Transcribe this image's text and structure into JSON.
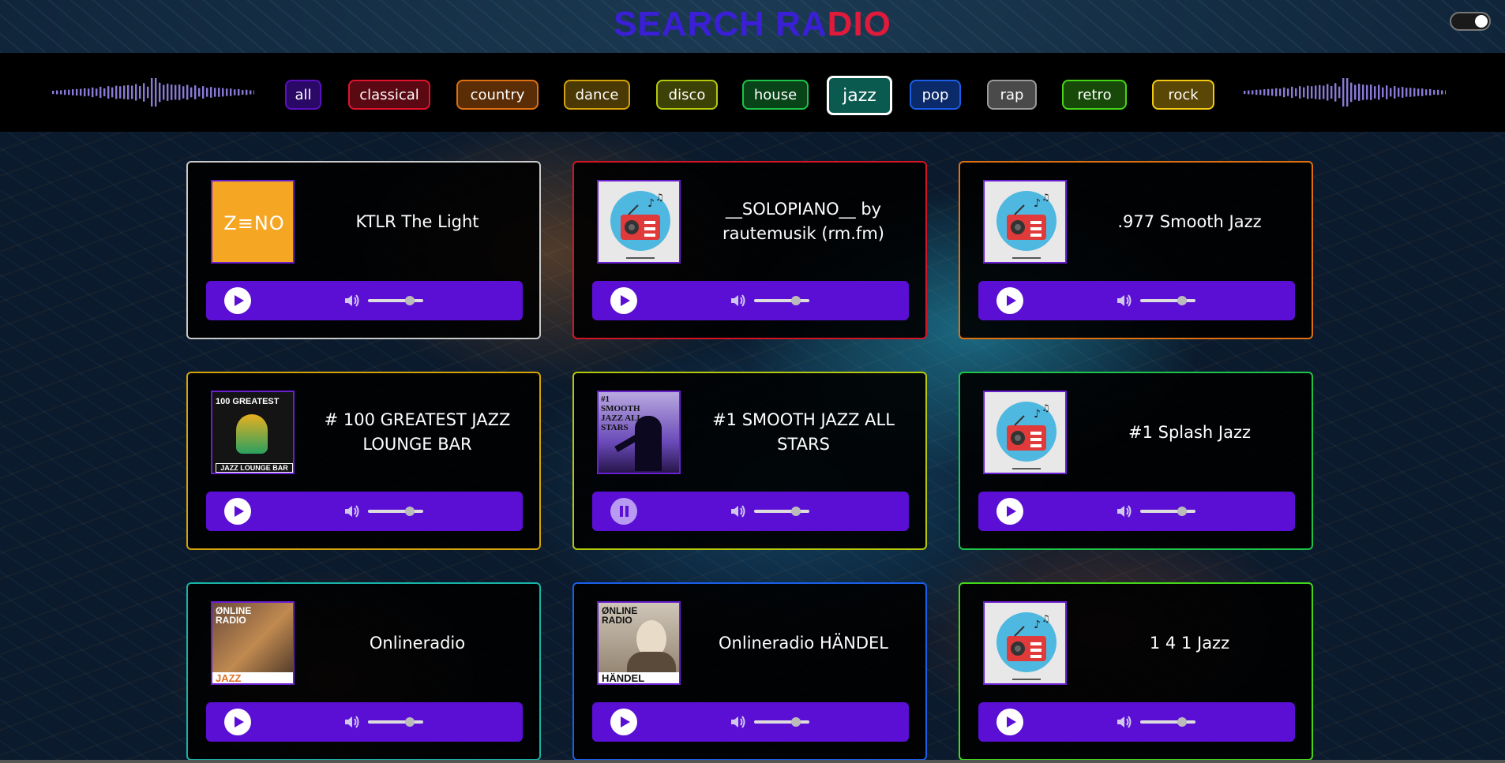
{
  "header": {
    "title_part1": "SEARCH RA",
    "title_part2": "DIO"
  },
  "genres": [
    {
      "label": "all",
      "color": "#5a10c0",
      "bg": "#2a0866"
    },
    {
      "label": "classical",
      "color": "#e0132d",
      "bg": "#5a0812"
    },
    {
      "label": "country",
      "color": "#e07010",
      "bg": "#5a2d06"
    },
    {
      "label": "dance",
      "color": "#d4a30a",
      "bg": "#4a3905"
    },
    {
      "label": "disco",
      "color": "#b5c80e",
      "bg": "#3c4205"
    },
    {
      "label": "house",
      "color": "#1ec34a",
      "bg": "#094418"
    },
    {
      "label": "jazz",
      "color": "#ffffff",
      "bg": "#0a5a50",
      "active": true
    },
    {
      "label": "pop",
      "color": "#1a5ee8",
      "bg": "#0b2a6a"
    },
    {
      "label": "rap",
      "color": "#9a9a9a",
      "bg": "#4a4a4a"
    },
    {
      "label": "retro",
      "color": "#45d61a",
      "bg": "#174a08"
    },
    {
      "label": "rock",
      "color": "#f2c915",
      "bg": "#5a4706"
    }
  ],
  "stations": [
    {
      "name": "KTLR The Light",
      "cover": "zeno-logo",
      "cover_text": "Z≡NO",
      "border": "#c9c9c9",
      "playing": false,
      "volume": 0.75
    },
    {
      "name": "__SOLOPIANO__ by rautemusik (rm.fm)",
      "cover": "radio-icon",
      "border": "#d41425",
      "playing": false,
      "volume": 0.75
    },
    {
      "name": ".977 Smooth Jazz",
      "cover": "radio-icon",
      "border": "#e0700f",
      "playing": false,
      "volume": 0.75
    },
    {
      "name": "# 100 GREATEST JAZZ LOUNGE BAR",
      "cover": "greatest-jazz-cover",
      "cover_text_top": "100 GREATEST",
      "cover_text_bottom": "JAZZ LOUNGE BAR",
      "border": "#d4a30a",
      "playing": false,
      "volume": 0.75
    },
    {
      "name": "#1 SMOOTH JAZZ ALL STARS",
      "cover": "smooth-jazz-cover",
      "cover_text": "#1 SMOOTH JAZZ ALL STARS",
      "border": "#b5c80e",
      "playing": true,
      "volume": 0.75
    },
    {
      "name": "#1 Splash Jazz",
      "cover": "radio-icon",
      "border": "#1ec34a",
      "playing": false,
      "volume": 0.75
    },
    {
      "name": "Onlineradio",
      "cover": "onlineradio-jazz-cover",
      "cover_text_top": "ØNLINE RADIO",
      "cover_text_bottom": "JAZZ",
      "border": "#18b3a8",
      "playing": false,
      "volume": 0.75
    },
    {
      "name": "Onlineradio HÄNDEL",
      "cover": "onlineradio-handel-cover",
      "cover_text_top": "ØNLINE RADIO",
      "cover_text_bottom": "HÄNDEL",
      "border": "#1a5ee8",
      "playing": false,
      "volume": 0.75
    },
    {
      "name": "1 4 1 Jazz",
      "cover": "radio-icon",
      "border": "#45d61a",
      "playing": false,
      "volume": 0.75
    }
  ]
}
